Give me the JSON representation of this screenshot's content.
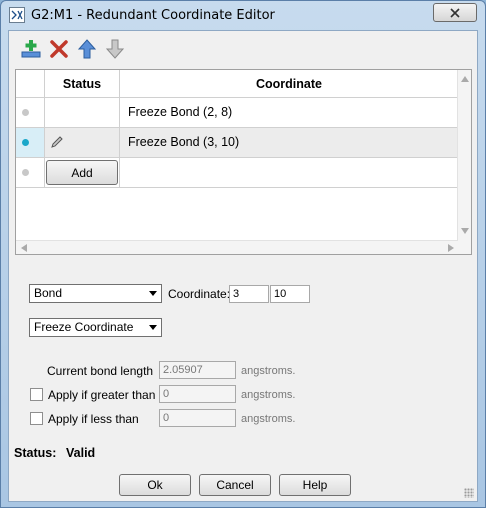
{
  "window": {
    "title": "G2:M1 - Redundant Coordinate Editor"
  },
  "toolbar": {
    "icons": [
      "add-coordinate-icon",
      "delete-icon",
      "move-up-icon",
      "move-down-icon"
    ]
  },
  "grid": {
    "headers": {
      "status": "Status",
      "coordinate": "Coordinate"
    },
    "rows": [
      {
        "coordinate": "Freeze Bond (2, 8)",
        "selected": false
      },
      {
        "coordinate": "Freeze Bond (3, 10)",
        "selected": true
      }
    ],
    "add_label": "Add"
  },
  "form": {
    "type_select": "Bond",
    "coordinate_label": "Coordinate:",
    "atom1": "3",
    "atom2": "10",
    "action_select": "Freeze Coordinate",
    "current_length_label": "Current bond length",
    "current_length_value": "2.05907",
    "current_length_unit": "angstroms.",
    "greater_label": "Apply if greater than",
    "greater_value": "0",
    "greater_unit": "angstroms.",
    "less_label": "Apply if less than",
    "less_value": "0",
    "less_unit": "angstroms."
  },
  "status": {
    "label": "Status:",
    "value": "Valid"
  },
  "buttons": {
    "ok": "Ok",
    "cancel": "Cancel",
    "help": "Help"
  },
  "colors": {
    "accent": "#1aa7c9",
    "add_icon": "#2aa84a",
    "delete_icon": "#c0392b",
    "arrow_icon": "#5a8fd8"
  }
}
